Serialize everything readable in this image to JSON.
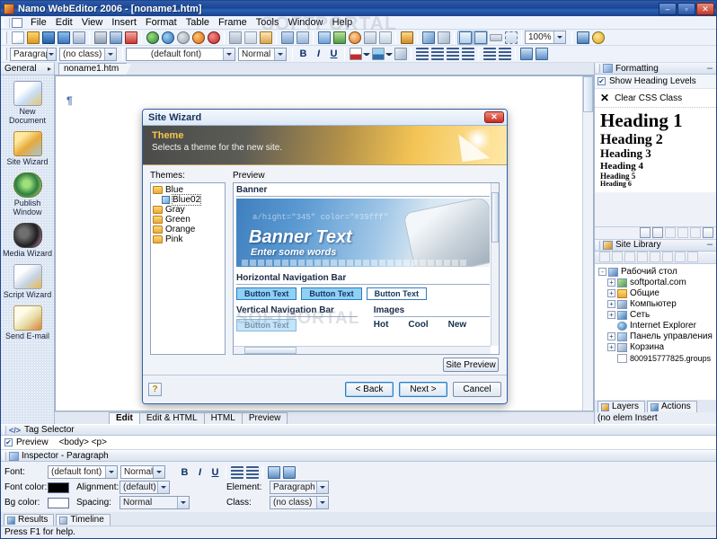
{
  "window": {
    "title": "Namo WebEditor 2006 - [noname1.htm]",
    "minimize": "–",
    "maximize": "▫",
    "close": "✕"
  },
  "menu": {
    "items": [
      "File",
      "Edit",
      "View",
      "Insert",
      "Format",
      "Table",
      "Frame",
      "Tools",
      "Window",
      "Help"
    ]
  },
  "watermark": "SOFTPORTAL",
  "toolbar_top": {
    "zoom_value": "100%",
    "icons": [
      "new-document-icon",
      "open-folder-icon",
      "save-icon",
      "save-all-icon",
      "preview-icon",
      "print-icon",
      "print-preview-icon",
      "spellcheck-icon",
      "publish-icon",
      "browser-icon",
      "globe-icon",
      "firefox-icon",
      "opera-icon",
      "cut-icon",
      "copy-icon",
      "paste-icon",
      "undo-icon",
      "redo-icon",
      "insert-table-icon",
      "insert-image-icon",
      "insert-link-icon",
      "insert-form-icon",
      "insert-frame-icon",
      "hotspot-icon",
      "link-icon",
      "unlink-icon",
      "table-grid-icon",
      "paragraph-mark-icon",
      "line-break-icon",
      "selection-icon",
      "properties-icon",
      "help-icon"
    ]
  },
  "toolbar_format": {
    "paragraph_style": "Paragraph",
    "css_class": "(no class)",
    "font_name": "(default font)",
    "font_size": "Normal",
    "bold": "B",
    "italic": "I",
    "underline": "U",
    "icons": [
      "font-color-icon",
      "highlight-color-icon",
      "clear-format-icon",
      "align-left-icon",
      "align-center-icon",
      "align-right-icon",
      "align-justify-icon",
      "ordered-list-icon",
      "unordered-list-icon",
      "indent-icon",
      "outdent-icon"
    ]
  },
  "left_panel": {
    "header": "General",
    "expander": "▸",
    "items": [
      {
        "label": "New Document",
        "icon": "new-document-icon"
      },
      {
        "label": "Site Wizard",
        "icon": "site-wizard-icon"
      },
      {
        "label": "Publish Window",
        "icon": "publish-window-icon"
      },
      {
        "label": "Media Wizard",
        "icon": "media-wizard-icon"
      },
      {
        "label": "Script Wizard",
        "icon": "script-wizard-icon"
      },
      {
        "label": "Send E-mail",
        "icon": "send-email-icon"
      }
    ]
  },
  "document": {
    "tab_label": "noname1.htm",
    "paragraph_mark": "¶"
  },
  "view_tabs": [
    {
      "label": "Edit",
      "selected": true
    },
    {
      "label": "Edit & HTML",
      "selected": false
    },
    {
      "label": "HTML",
      "selected": false
    },
    {
      "label": "Preview",
      "selected": false
    }
  ],
  "tag_selector": {
    "title": "Tag Selector",
    "title_icon": "code-brackets-icon",
    "preview_label": "Preview",
    "preview_checked": "✔",
    "tags": "<body>  <p>"
  },
  "inspector": {
    "title": "Inspector - Paragraph",
    "title_icon": "inspector-icon",
    "font_label": "Font:",
    "font_value": "(default font)",
    "font_size_value": "Normal",
    "font_color_label": "Font color:",
    "font_color_value": "#000000",
    "bg_color_label": "Bg color:",
    "bg_color_value": "#ffffff",
    "alignment_label": "Alignment:",
    "alignment_value": "(default)",
    "spacing_label": "Spacing:",
    "spacing_value": "Normal",
    "element_label": "Element:",
    "element_value": "Paragraph",
    "class_label": "Class:",
    "class_value": "(no class)",
    "bold": "B",
    "italic": "I",
    "underline": "U"
  },
  "bottom_tabs": [
    {
      "label": "Results",
      "icon": "results-icon"
    },
    {
      "label": "Timeline",
      "icon": "timeline-icon"
    }
  ],
  "statusbar": {
    "text": "Press F1 for help."
  },
  "formatting_panel": {
    "title": "Formatting",
    "title_icon": "formatting-icon",
    "minimize": "–",
    "show_heading_levels": "Show Heading Levels",
    "show_heading_checked": "✔",
    "clear_css_class": "Clear CSS Class",
    "clear_icon": "x-icon",
    "headings": [
      "Heading 1",
      "Heading 2",
      "Heading 3",
      "Heading 4",
      "Heading 5",
      "Heading 6"
    ]
  },
  "site_library": {
    "title": "Site Library",
    "title_icon": "site-library-icon",
    "minimize": "–",
    "tree": [
      {
        "label": "Рабочий стол",
        "depth": 0,
        "expander": "-",
        "icon": "desktop-icon"
      },
      {
        "label": "softportal.com",
        "depth": 1,
        "expander": "+",
        "icon": "site-icon"
      },
      {
        "label": "Общие",
        "depth": 1,
        "expander": "+",
        "icon": "folder-icon"
      },
      {
        "label": "Компьютер",
        "depth": 1,
        "expander": "+",
        "icon": "computer-icon"
      },
      {
        "label": "Сеть",
        "depth": 1,
        "expander": "+",
        "icon": "network-icon"
      },
      {
        "label": "Internet Explorer",
        "depth": 1,
        "expander": "",
        "icon": "ie-icon"
      },
      {
        "label": "Панель управления",
        "depth": 1,
        "expander": "+",
        "icon": "control-panel-icon"
      },
      {
        "label": "Корзина",
        "depth": 1,
        "expander": "+",
        "icon": "recycle-bin-icon"
      },
      {
        "label": "800915777825.groups",
        "depth": 1,
        "expander": "",
        "icon": "file-icon"
      }
    ]
  },
  "right_bottom_tabs": [
    {
      "label": "Layers",
      "icon": "layers-icon"
    },
    {
      "label": "Actions",
      "icon": "actions-icon"
    }
  ],
  "right_status": {
    "text": "(no elem  Insert"
  },
  "dialog": {
    "title": "Site Wizard",
    "close": "✕",
    "banner_title": "Theme",
    "banner_subtitle": "Selects a theme for the new site.",
    "themes_label": "Themes:",
    "preview_label": "Preview",
    "themes": [
      {
        "label": "Blue",
        "depth": 0,
        "icon": "folder-icon",
        "selected": false
      },
      {
        "label": "Blue02",
        "depth": 1,
        "icon": "file-icon",
        "selected": true
      },
      {
        "label": "Gray",
        "depth": 0,
        "icon": "folder-icon",
        "selected": false
      },
      {
        "label": "Green",
        "depth": 0,
        "icon": "folder-icon",
        "selected": false
      },
      {
        "label": "Orange",
        "depth": 0,
        "icon": "folder-icon",
        "selected": false
      },
      {
        "label": "Pink",
        "depth": 0,
        "icon": "folder-icon",
        "selected": false
      }
    ],
    "preview": {
      "banner_section": "Banner",
      "banner_code_text": "a/hight=\"345\" color=\"#39fff\"",
      "banner_text": "Banner Text",
      "banner_subtext": "Enter some words",
      "hnav_section": "Horizontal Navigation Bar",
      "nav_buttons": [
        "Button Text",
        "Button Text",
        "Button Text"
      ],
      "vnav_section": "Vertical Navigation Bar",
      "vnav_button": "Button Text",
      "images_section": "Images",
      "image_labels": [
        "Hot",
        "Cool",
        "New"
      ]
    },
    "site_preview_button": "Site Preview",
    "help_button": "?",
    "back_button": "< Back",
    "next_button": "Next >",
    "cancel_button": "Cancel"
  }
}
